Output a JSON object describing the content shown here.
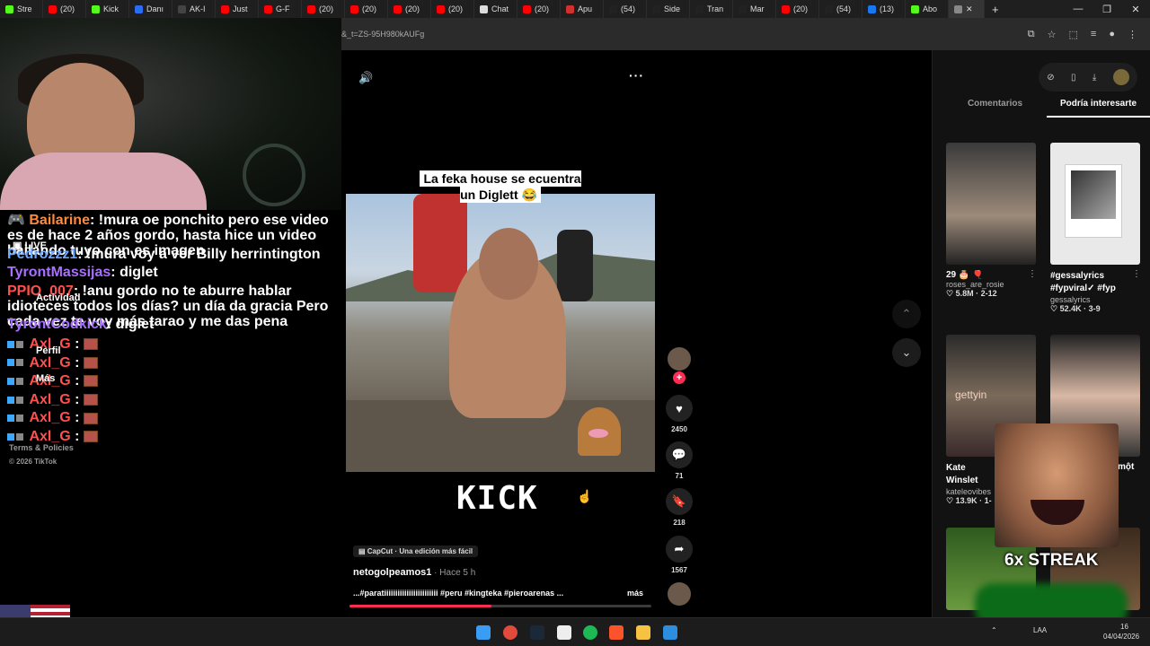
{
  "browser": {
    "tabs": [
      {
        "label": "Stre",
        "color": "#53fc18"
      },
      {
        "label": "(20)",
        "color": "#ff0000"
      },
      {
        "label": "Kick",
        "color": "#53fc18"
      },
      {
        "label": "Danı",
        "color": "#2a6df4"
      },
      {
        "label": "AK-I",
        "color": "#444444"
      },
      {
        "label": "Just",
        "color": "#ff0000"
      },
      {
        "label": "G-F",
        "color": "#ff0000"
      },
      {
        "label": "(20)",
        "color": "#ff0000"
      },
      {
        "label": "(20)",
        "color": "#ff0000"
      },
      {
        "label": "(20)",
        "color": "#ff0000"
      },
      {
        "label": "(20)",
        "color": "#ff0000"
      },
      {
        "label": "Chat",
        "color": "#dddddd"
      },
      {
        "label": "(20)",
        "color": "#ff0000"
      },
      {
        "label": "Apu",
        "color": "#d32f2f"
      },
      {
        "label": "(54)",
        "color": "#222222"
      },
      {
        "label": "Side",
        "color": "#222222"
      },
      {
        "label": "Tran",
        "color": "#222222"
      },
      {
        "label": "Mar",
        "color": "#222222"
      },
      {
        "label": "(20)",
        "color": "#ff0000"
      },
      {
        "label": "(54)",
        "color": "#222222"
      },
      {
        "label": "(13)",
        "color": "#1877f2"
      },
      {
        "label": "Abo",
        "color": "#53fc18"
      }
    ],
    "url": "&_t=ZS-95H980kAUFg"
  },
  "chat": {
    "messages": [
      {
        "user": "Bailarine",
        "text": ": !mura oe ponchito pero ese video es de hace 2 años gordo, hasta hice un video bailando tuyo con es imagen",
        "color": "#ff8a3d"
      },
      {
        "user": "Pedrozzz1",
        "text": ": !mura voy a ver Billy herrintington",
        "color": "#6fa8ff"
      },
      {
        "user": "TyrontMassijas",
        "text": ": diglet",
        "color": "#a970ff"
      },
      {
        "user": "PPIO_007",
        "text": ": !anu gordo no te aburre hablar idioteces todos los días? un día da gracia Pero cada vez te voy más tarao y me das pena",
        "color": "#ff4f4f"
      },
      {
        "user": "TyrontCodkick",
        "text": ": diglet",
        "color": "#a970ff"
      }
    ],
    "spam_user": "Axl_G",
    "overlay_nav": {
      "live": "LIVE",
      "activity": "Actividad",
      "profile": "Perfil",
      "more": "Más"
    },
    "footer": {
      "terms": "Terms & Policies",
      "copyright": "© 2026 TikTok"
    }
  },
  "video": {
    "caption": "La feka house se ecuentra un Diglett 😂",
    "watermark": "KICK",
    "capcut": "CapCut · Una edición más fácil",
    "author": "netogolpeamos1",
    "time": " · Hace 5 h",
    "description": "...#paratiiiiiiiiiiiiiiiiiiiiiiii #peru #kingteka #pieroarenas ...",
    "more": "más",
    "progress": 0.47,
    "likes": "2450",
    "comments": "71",
    "saves": "218",
    "shares": "1567"
  },
  "sidebar": {
    "tab_comments": "Comentarios",
    "tab_interest": "Podría interesarte",
    "items": [
      {
        "title": "29 🎂 🎈",
        "user": "roses_are_rosie",
        "stats": "♡ 5.8M · 2-12"
      },
      {
        "title": "#gessalyrics #fypviral✓ #fyp",
        "user": "gessalyrics",
        "stats": "♡ 52.4K · 3-9"
      },
      {
        "title": "Kate Winslet Leonardo D",
        "user": "kateleovibes",
        "stats": "♡ 13.9K · 1-"
      },
      {
        "title": "một",
        "user": "",
        "stats": ""
      }
    ],
    "thumb_text": "gettyin"
  },
  "overlay": {
    "streak": "6x STREAK"
  },
  "taskbar": {
    "lang": "LAA",
    "date": "04/04/2026",
    "time": "16"
  }
}
